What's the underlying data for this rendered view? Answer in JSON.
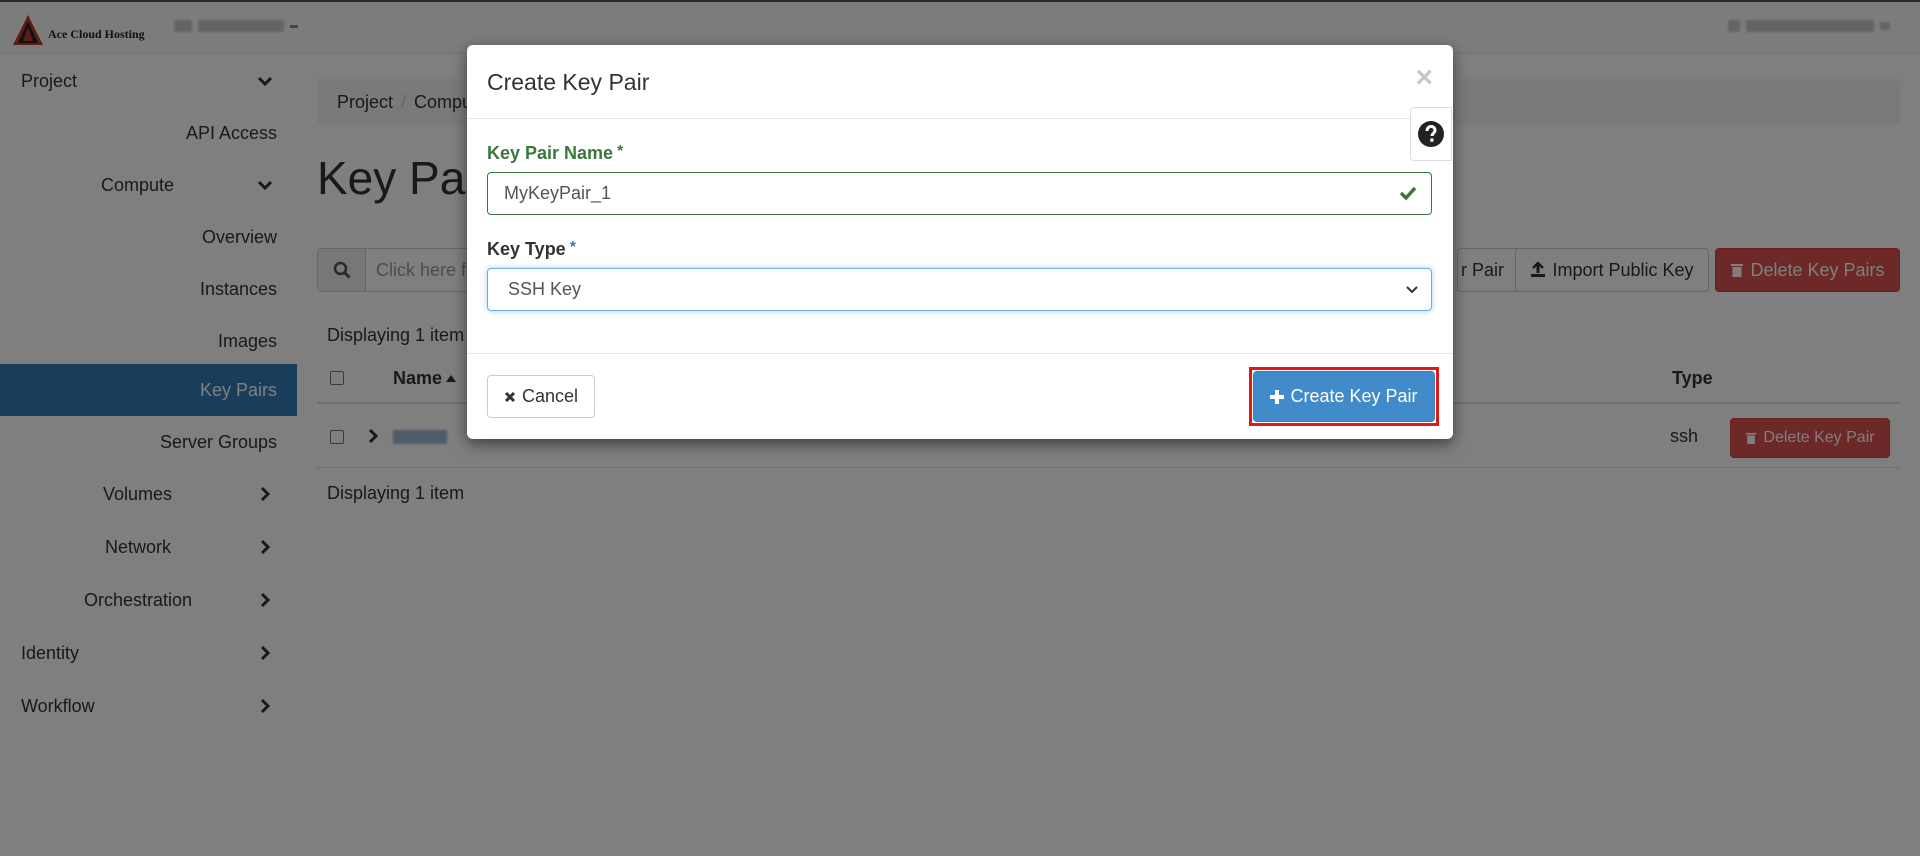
{
  "brand": {
    "name": "Ace Cloud Hosting"
  },
  "sidebar": {
    "items": [
      {
        "label": "Project",
        "chevron": "down"
      },
      {
        "label": "API Access"
      },
      {
        "label": "Compute",
        "chevron": "down"
      },
      {
        "label": "Overview"
      },
      {
        "label": "Instances"
      },
      {
        "label": "Images"
      },
      {
        "label": "Key Pairs",
        "active": true
      },
      {
        "label": "Server Groups"
      },
      {
        "label": "Volumes",
        "chevron": "right"
      },
      {
        "label": "Network",
        "chevron": "right"
      },
      {
        "label": "Orchestration",
        "chevron": "right"
      },
      {
        "label": "Identity",
        "chevron": "right"
      },
      {
        "label": "Workflow",
        "chevron": "right"
      }
    ]
  },
  "main": {
    "breadcrumb": [
      "Project",
      "Compu"
    ],
    "page_title": "Key Pai",
    "search_placeholder": "Click here fo",
    "actions": {
      "create_partial": "r Pair",
      "import": "Import Public Key",
      "delete": "Delete Key Pairs"
    },
    "displaying_top": "Displaying 1 item",
    "displaying_bottom": "Displaying 1 item",
    "table": {
      "columns": {
        "name": "Name",
        "type": "Type"
      },
      "rows": [
        {
          "type": "ssh",
          "action": "Delete Key Pair"
        }
      ]
    }
  },
  "modal": {
    "title": "Create Key Pair",
    "close": "×",
    "fields": {
      "name_label": "Key Pair Name",
      "name_value": "MyKeyPair_1",
      "type_label": "Key Type",
      "type_value": "SSH Key",
      "required_mark": "*"
    },
    "buttons": {
      "cancel": "Cancel",
      "create": "Create Key Pair"
    }
  },
  "colors": {
    "primary": "#337ab7",
    "success": "#3c763d",
    "danger": "#d9534f",
    "highlight": "#e01818"
  }
}
